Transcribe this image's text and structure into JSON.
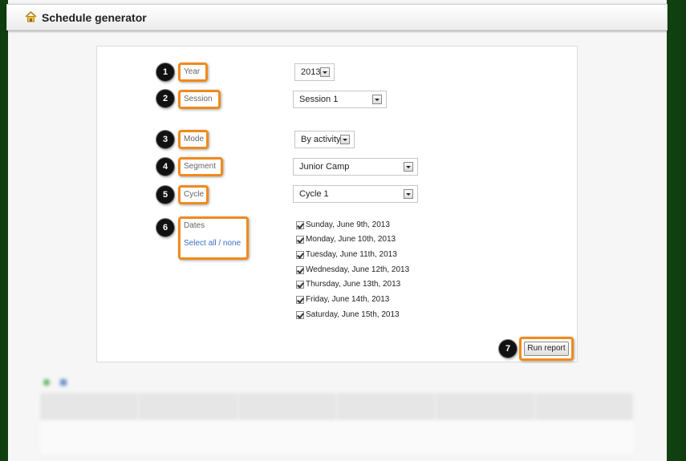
{
  "header": {
    "title": "Schedule generator",
    "icon": "home-icon"
  },
  "form": {
    "year": {
      "label": "Year",
      "value": "2013",
      "step": "1"
    },
    "session": {
      "label": "Session",
      "value": "Session 1",
      "step": "2"
    },
    "mode": {
      "label": "Mode",
      "value": "By activity",
      "step": "3"
    },
    "segment": {
      "label": "Segment",
      "value": "Junior Camp",
      "step": "4"
    },
    "cycle": {
      "label": "Cycle",
      "value": "Cycle 1",
      "step": "5"
    },
    "dates": {
      "label": "Dates",
      "select_link": "Select all / none",
      "step": "6",
      "items": [
        {
          "label": "Sunday, June 9th, 2013",
          "checked": true
        },
        {
          "label": "Monday, June 10th, 2013",
          "checked": true
        },
        {
          "label": "Tuesday, June 11th, 2013",
          "checked": true
        },
        {
          "label": "Wednesday, June 12th, 2013",
          "checked": true
        },
        {
          "label": "Thursday, June 13th, 2013",
          "checked": true
        },
        {
          "label": "Friday, June 14th, 2013",
          "checked": true
        },
        {
          "label": "Saturday, June 15th, 2013",
          "checked": true
        }
      ]
    },
    "run_button": {
      "label": "Run report",
      "step": "7"
    }
  },
  "colors": {
    "highlight": "#f08a1c",
    "link": "#3c6fcf",
    "background": "#1f5f1f"
  }
}
